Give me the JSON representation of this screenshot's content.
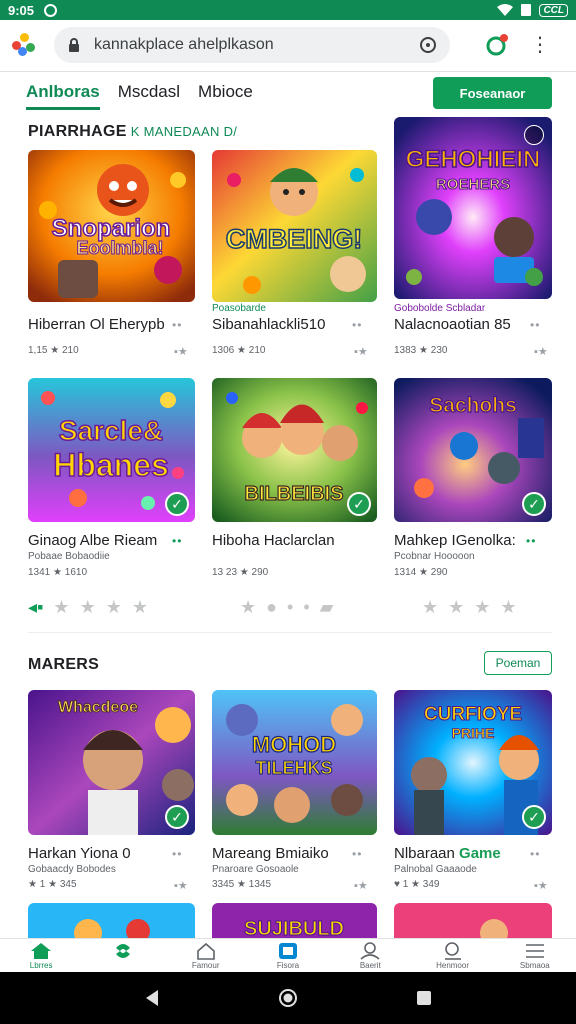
{
  "status": {
    "time": "9:05",
    "battery": "CCL"
  },
  "browser": {
    "url": "kannakplace ahelplkason"
  },
  "tabs": [
    {
      "label": "Anlboras",
      "active": true
    },
    {
      "label": "Mscdasl",
      "active": false
    },
    {
      "label": "Mbioce",
      "active": false
    }
  ],
  "cta_label": "Foseanaor",
  "section1": {
    "title": "PIARRHAGE",
    "accent": "K MANEDAAN D/"
  },
  "section2": {
    "title": "MARERS",
    "button": "Poeman"
  },
  "row1": [
    {
      "name": "Hiberran Ol Eherypb",
      "sub": "",
      "meta": "1,15 ★ 210",
      "tile_title": "Snoparion",
      "tile_sub": "Eoolmbla!"
    },
    {
      "name": "Sibanahlackli510",
      "sub": "Poasobarde",
      "meta": "1306 ★ 210",
      "tile_title": "CMBEING!",
      "tile_sub": ""
    },
    {
      "name": "Nalacnoaotian 85",
      "sub": "Gobobolde Scbladar",
      "meta": "1383 ★ 230",
      "tile_title": "GEHOHIEIN",
      "tile_sub": "ROEHERS"
    }
  ],
  "row2": [
    {
      "name": "Ginaog Albe Rieam",
      "sub": "Pobaae Bobaodiie",
      "meta": "1341 ★ 1610",
      "tile_title": "Sarcle&",
      "tile_sub": "Hbanes"
    },
    {
      "name": "Hiboha Haclarclan",
      "sub": "",
      "meta": "13 23 ★ 290",
      "tile_title": "BILBEIBIS",
      "tile_sub": ""
    },
    {
      "name": "Mahkep IGenolka:",
      "sub": "Pcobnar Hooooon",
      "meta": "1314 ★ 290",
      "tile_title": "Sachohs",
      "tile_sub": ""
    }
  ],
  "row3": [
    {
      "name": "Harkan Yiona 0",
      "sub": "Gobaacdy Bobodes",
      "meta": "★ 1 ★ 345",
      "tile_title": "Whacdeoe",
      "tile_sub": ""
    },
    {
      "name": "Mareang Bmiaiko",
      "sub": "Pnaroare Gosoaole",
      "meta": "3345 ★ 1345",
      "tile_title": "MOHOD",
      "tile_sub": "TILEHKS"
    },
    {
      "name": "Nlbaraan Game",
      "name_plain": "Nlbaraan ",
      "name_green": "Game",
      "sub": "Palnobal Gaaaode",
      "meta": "♥ 1 ★ 349",
      "tile_title": "CURFIOYE",
      "tile_sub": "PRIHE"
    }
  ],
  "row4_titles": [
    "",
    "SUJIBULD",
    ""
  ],
  "bottom_nav": [
    {
      "label": "Lbrres",
      "icon": "home-icon",
      "active": true
    },
    {
      "label": "",
      "icon": "games-icon",
      "active": false
    },
    {
      "label": "Famour",
      "icon": "store-icon",
      "active": false
    },
    {
      "label": "Fisora",
      "icon": "apps-icon",
      "active": false
    },
    {
      "label": "Baerit",
      "icon": "user-icon",
      "active": false
    },
    {
      "label": "Henmoor",
      "icon": "search-icon",
      "active": false
    },
    {
      "label": "Sbmaoa",
      "icon": "menu-icon",
      "active": false
    }
  ],
  "colors": {
    "brand_green": "#0f9d58",
    "status_green": "#0f8a55"
  }
}
